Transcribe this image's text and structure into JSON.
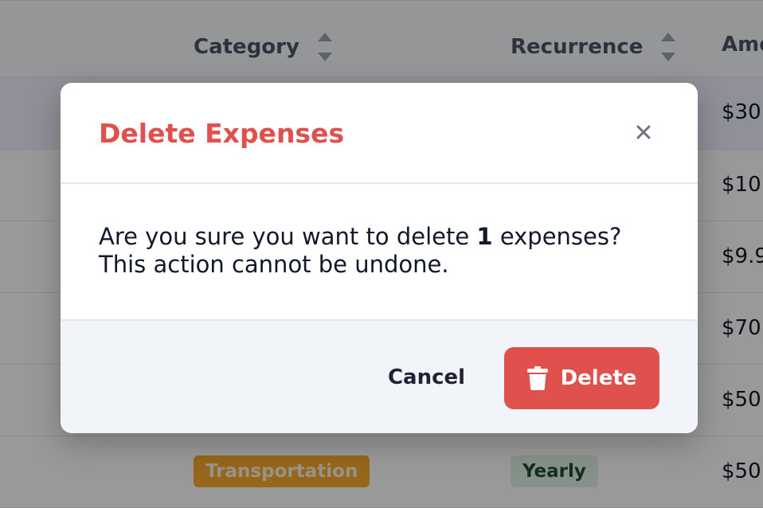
{
  "table": {
    "columns": [
      {
        "label": "Category"
      },
      {
        "label": "Recurrence"
      },
      {
        "label": "Amo"
      }
    ],
    "rows": [
      {
        "amount": "$30"
      },
      {
        "amount": "$10."
      },
      {
        "amount": "$9.9"
      },
      {
        "amount": "$70"
      },
      {
        "amount": "$50"
      },
      {
        "amount": "$50",
        "category": "Transportation",
        "recurrence": "Yearly"
      }
    ]
  },
  "modal": {
    "title": "Delete Expenses",
    "close_icon": "close-icon",
    "message_prefix": "Are you sure you want to delete",
    "count": "1",
    "message_suffix": "expenses?",
    "message_line2": "This action cannot be undone.",
    "cancel_label": "Cancel",
    "delete_label": "Delete",
    "delete_icon": "trash-icon"
  },
  "colors": {
    "danger": "#e0514e",
    "transport_badge": "#fbac2c",
    "yearly_badge": "#dff4e4"
  }
}
